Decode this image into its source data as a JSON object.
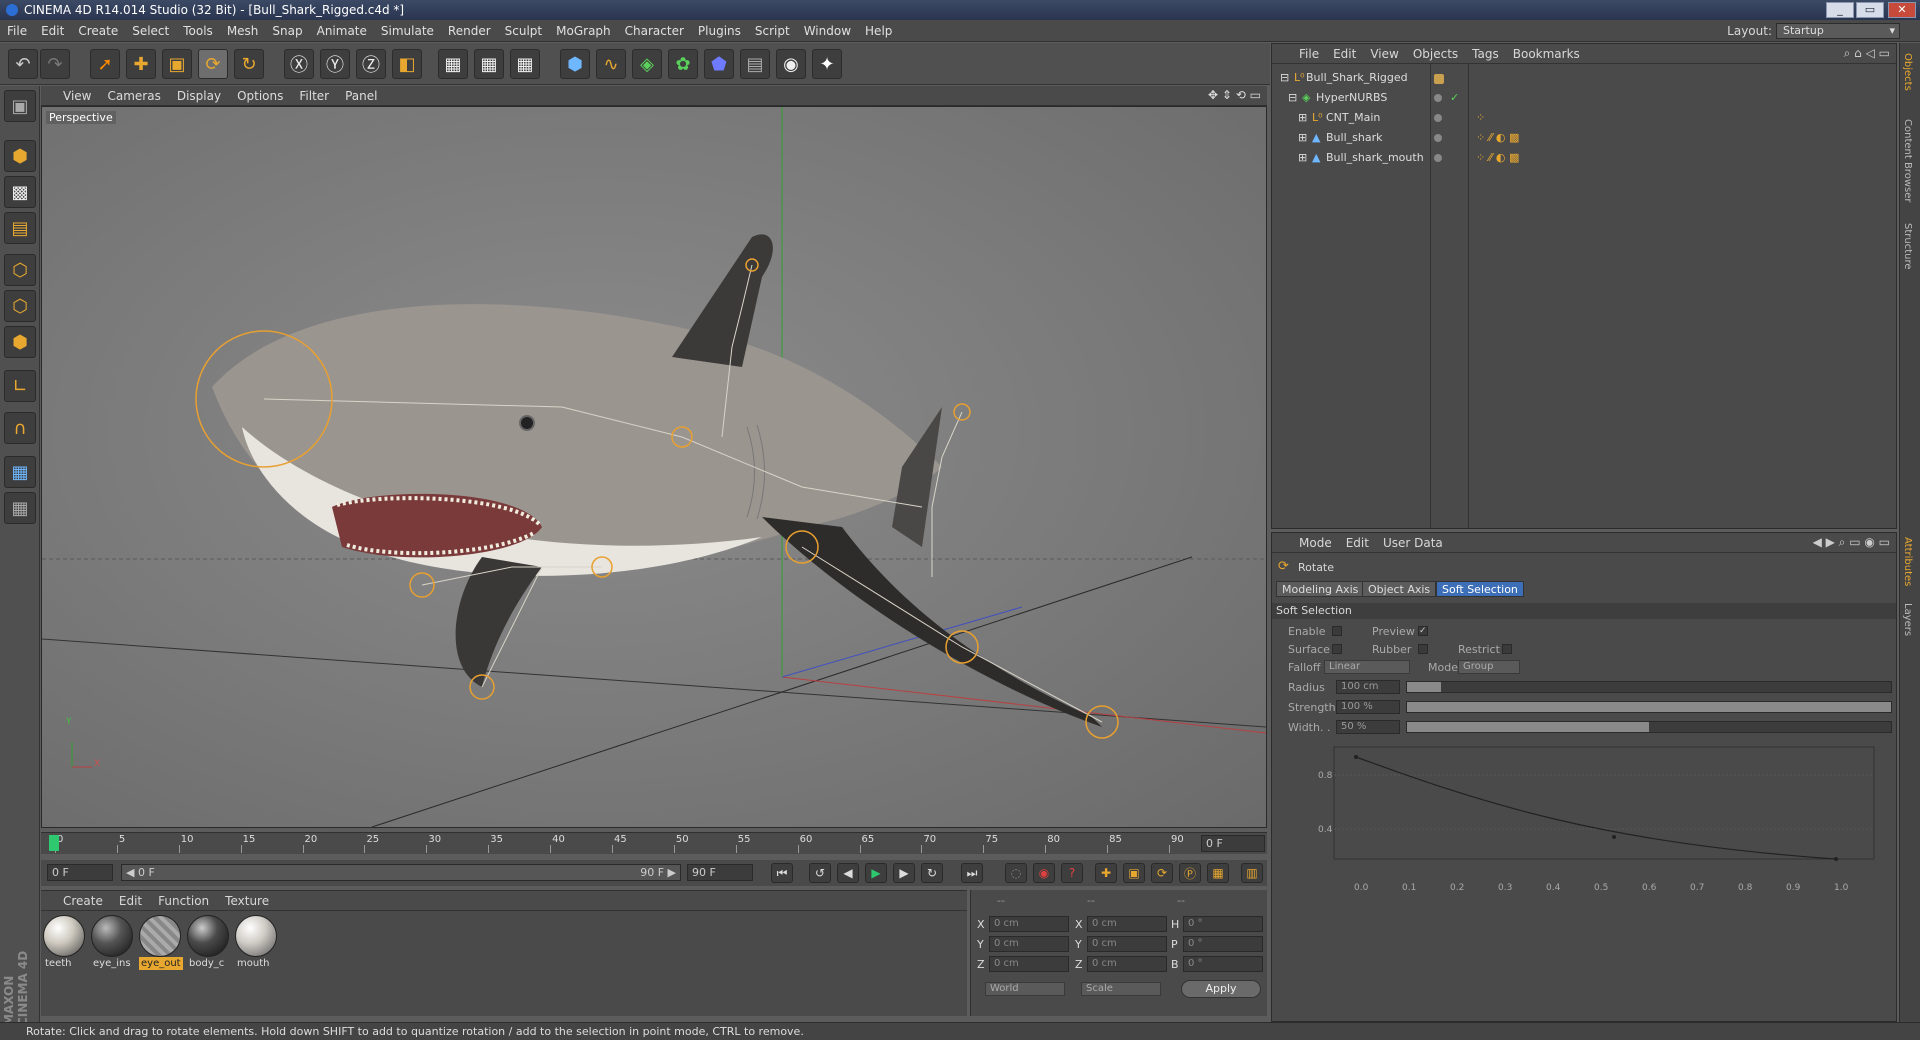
{
  "window": {
    "title": "CINEMA 4D R14.014 Studio (32 Bit) - [Bull_Shark_Rigged.c4d *]",
    "buttons": [
      "_",
      "▭",
      "✕"
    ]
  },
  "menubar": {
    "items": [
      "File",
      "Edit",
      "Create",
      "Select",
      "Tools",
      "Mesh",
      "Snap",
      "Animate",
      "Simulate",
      "Render",
      "Sculpt",
      "MoGraph",
      "Character",
      "Plugins",
      "Script",
      "Window",
      "Help"
    ],
    "layout_label": "Layout:",
    "layout_value": "Startup"
  },
  "viewport": {
    "menu": [
      "View",
      "Cameras",
      "Display",
      "Options",
      "Filter",
      "Panel"
    ],
    "label": "Perspective",
    "axis_y": "Y",
    "axis_x": "X"
  },
  "timeline": {
    "ticks": [
      "0",
      "5",
      "10",
      "15",
      "20",
      "25",
      "30",
      "35",
      "40",
      "45",
      "50",
      "55",
      "60",
      "65",
      "70",
      "75",
      "80",
      "85",
      "90"
    ],
    "current_frame": "0 F",
    "start_field": "0 F",
    "range_start": "◀ 0 F",
    "range_end": "90 F ▶",
    "end_field": "90 F"
  },
  "materials": {
    "menu": [
      "Create",
      "Edit",
      "Function",
      "Texture"
    ],
    "items": [
      {
        "label": "teeth",
        "color": "#cfcac0"
      },
      {
        "label": "eye_ins",
        "color": "#555555"
      },
      {
        "label": "eye_out",
        "color": "#9a9a9a"
      },
      {
        "label": "body_c",
        "color": "#4a4a4a"
      },
      {
        "label": "mouth",
        "color": "#d0ccc6"
      }
    ],
    "selected_label": "eye_out"
  },
  "coords": {
    "header": [
      "--",
      "--",
      "--"
    ],
    "rows": [
      {
        "a": "X",
        "av": "0 cm",
        "b": "X",
        "bv": "0 cm",
        "c": "H",
        "cv": "0 °"
      },
      {
        "a": "Y",
        "av": "0 cm",
        "b": "Y",
        "bv": "0 cm",
        "c": "P",
        "cv": "0 °"
      },
      {
        "a": "Z",
        "av": "0 cm",
        "b": "Z",
        "bv": "0 cm",
        "c": "B",
        "cv": "0 °"
      }
    ],
    "mode1": "World",
    "mode2": "Scale",
    "apply": "Apply"
  },
  "objects": {
    "menu": [
      "File",
      "Edit",
      "View",
      "Objects",
      "Tags",
      "Bookmarks"
    ],
    "rows": [
      {
        "name": "Bull_Shark_Rigged"
      },
      {
        "name": "HyperNURBS"
      },
      {
        "name": "CNT_Main"
      },
      {
        "name": "Bull_shark"
      },
      {
        "name": "Bull_shark_mouth"
      }
    ]
  },
  "attributes": {
    "menu": [
      "Mode",
      "Edit",
      "User Data"
    ],
    "tool_name": "Rotate",
    "tabs": [
      "Modeling Axis",
      "Object Axis",
      "Soft Selection"
    ],
    "section": "Soft Selection",
    "enable": "Enable",
    "preview": "Preview",
    "surface": "Surface",
    "rubber": "Rubber",
    "restrict": "Restrict",
    "falloff_label": "Falloff",
    "falloff_value": "Linear",
    "mode_label": "Mode",
    "mode_value": "Group",
    "radius_label": "Radius",
    "radius_value": "100 cm",
    "strength_label": "Strength",
    "strength_value": "100 %",
    "width_label": "Width. .",
    "width_value": "50 %",
    "radius_level": 0.07,
    "strength_level": 1.0,
    "width_level": 0.5,
    "graph_y": [
      "0.8",
      "0.4"
    ],
    "graph_x": [
      "0.0",
      "0.1",
      "0.2",
      "0.3",
      "0.4",
      "0.5",
      "0.6",
      "0.7",
      "0.8",
      "0.9",
      "1.0"
    ]
  },
  "right_tabs": [
    "Objects",
    "Content Browser",
    "Structure",
    "Attributes",
    "Layers"
  ],
  "status": "Rotate: Click and drag to rotate elements. Hold down SHIFT to add to quantize rotation / add to the selection in point mode, CTRL to remove.",
  "brand": "MAXON CINEMA 4D",
  "colors": {
    "accent": "#e8a830",
    "selection": "#3d6fb8"
  }
}
